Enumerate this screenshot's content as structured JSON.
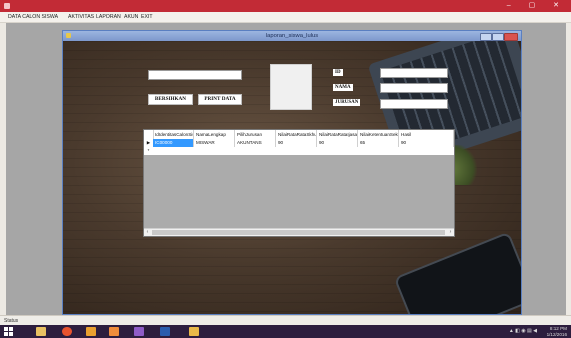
{
  "app": {
    "menu": [
      "DATA CALON SISWA",
      "AKTIVITAS",
      "LAPORAN",
      "AKUN",
      "EXIT"
    ],
    "window_controls": "– ▢ ✕",
    "status": "Status"
  },
  "form": {
    "title": "laporan_siswa_lulus",
    "buttons": {
      "clear": "BERSIHKAN",
      "print": "PRINT DATA"
    },
    "labels": {
      "id": "ID",
      "nama": "NAMA",
      "jurusan": "JURUSAN"
    },
    "search_value": "",
    "id_value": "",
    "nama_value": "",
    "jurusan_value": ""
  },
  "grid": {
    "columns": [
      "IdIdentitasCalonSis",
      "NamaLengkap",
      "PilihJurusan",
      "NilaiRataRataSkhu",
      "NilaiRataRataIjasah",
      "NilaiKetentuanSeko",
      "Hasil"
    ],
    "rows": [
      [
        "IC00000",
        "MISWAR",
        "AKUNTANS",
        "90",
        "90",
        "65",
        "90"
      ]
    ],
    "current_row_marker": "▶",
    "new_row_marker": "*"
  },
  "taskbar": {
    "time": "8:12 PM",
    "date": "1/12/2016",
    "tray_icons": "▲ ◧ ◉ ▤ ◀"
  },
  "colors": {
    "titlebar": "#c22b36",
    "child_titlebar": "#8ca6d6",
    "selected_cell": "#3399ff",
    "taskbar": "#2d1e3e"
  }
}
